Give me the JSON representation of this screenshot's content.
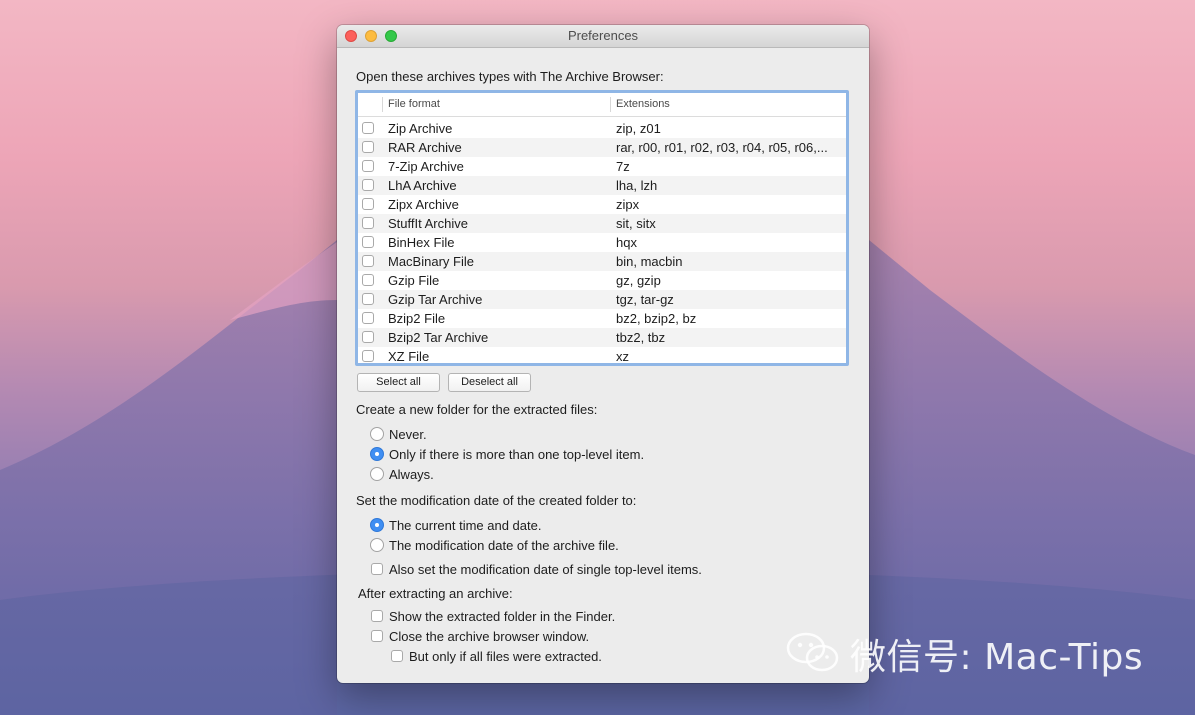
{
  "window": {
    "title": "Preferences"
  },
  "archives": {
    "heading": "Open these archives types with The Archive Browser:",
    "columns": {
      "format": "File format",
      "extensions": "Extensions"
    },
    "rows": [
      {
        "name": "Zip Archive",
        "ext": "zip, z01"
      },
      {
        "name": "RAR Archive",
        "ext": "rar, r00, r01, r02, r03, r04, r05, r06,..."
      },
      {
        "name": "7-Zip Archive",
        "ext": "7z"
      },
      {
        "name": "LhA Archive",
        "ext": "lha, lzh"
      },
      {
        "name": "Zipx Archive",
        "ext": "zipx"
      },
      {
        "name": "StuffIt Archive",
        "ext": "sit, sitx"
      },
      {
        "name": "BinHex File",
        "ext": "hqx"
      },
      {
        "name": "MacBinary File",
        "ext": "bin, macbin"
      },
      {
        "name": "Gzip File",
        "ext": "gz, gzip"
      },
      {
        "name": "Gzip Tar Archive",
        "ext": "tgz, tar-gz"
      },
      {
        "name": "Bzip2 File",
        "ext": "bz2, bzip2, bz"
      },
      {
        "name": "Bzip2 Tar Archive",
        "ext": "tbz2, tbz"
      },
      {
        "name": "XZ File",
        "ext": "xz"
      }
    ],
    "select_all": "Select all",
    "deselect_all": "Deselect all"
  },
  "new_folder": {
    "heading": "Create a new folder for the extracted files:",
    "options": [
      "Never.",
      "Only if there is more than one top-level item.",
      "Always."
    ],
    "selected": 1
  },
  "mod_date": {
    "heading": "Set the modification date of the created folder to:",
    "options": [
      "The current time and date.",
      "The modification date of the archive file."
    ],
    "selected": 0,
    "also_label": "Also set the modification date of single top-level items."
  },
  "after": {
    "heading": "After extracting an archive:",
    "show_finder": "Show the extracted folder in the Finder.",
    "close_window": "Close the archive browser window.",
    "only_if": "But only if all files were extracted."
  },
  "watermark": {
    "text": "微信号: Mac-Tips"
  },
  "colors": {
    "accent": "#3f8ef2",
    "focus_ring": "#8fb6e6"
  }
}
